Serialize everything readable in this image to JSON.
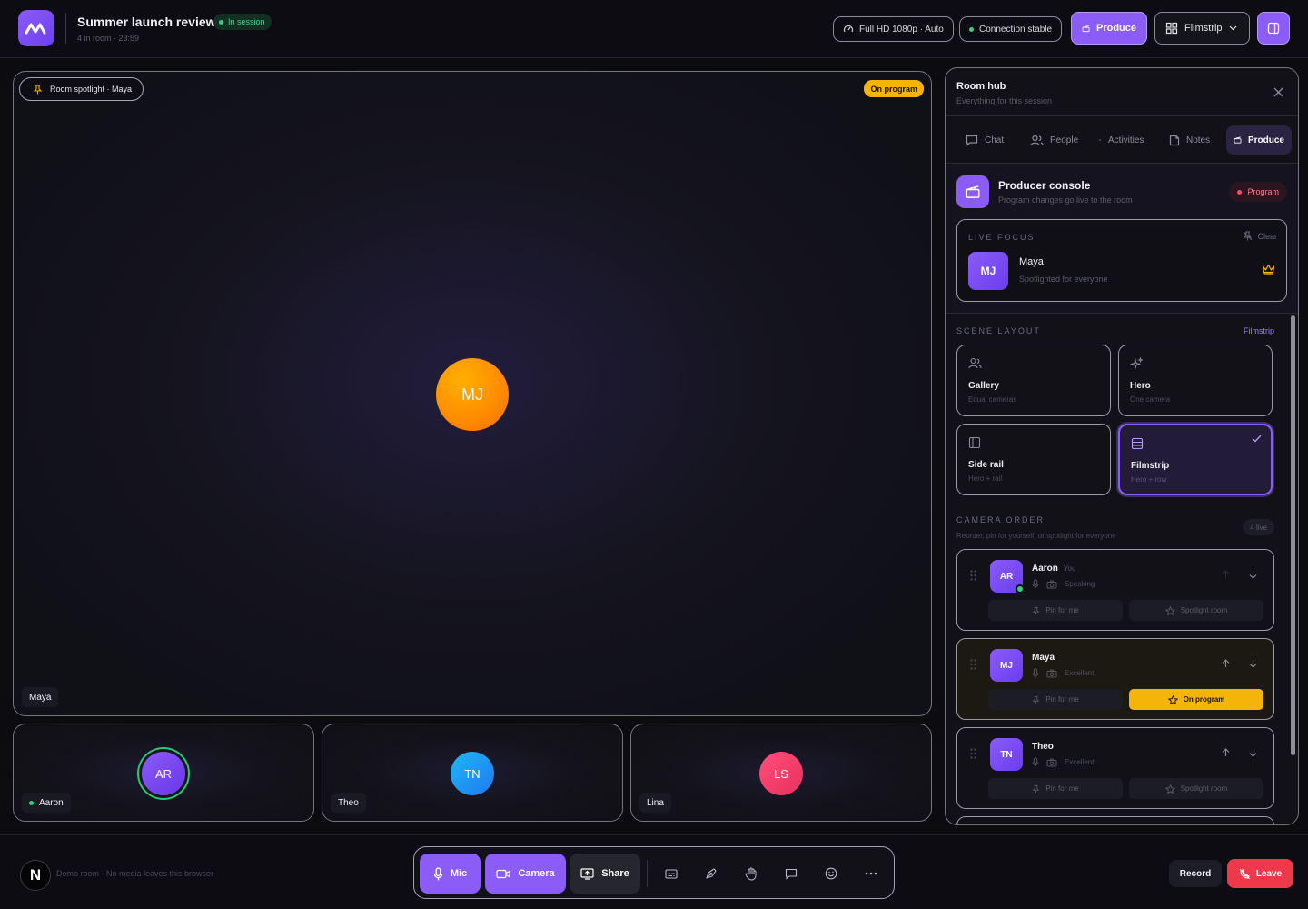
{
  "app": {
    "title": "Summer launch review",
    "status_badge": "In session",
    "subtitle": "4 in room · 23:59"
  },
  "topbar": {
    "quality_label": "Full HD 1080p · Auto",
    "connection_label": "Connection stable",
    "produce_label": "Produce",
    "layout_label": "Filmstrip"
  },
  "stage": {
    "spotlight_label": "Room spotlight · Maya",
    "program_badge": "On program",
    "avatar_initials": "MJ",
    "name": "Maya"
  },
  "tiles": [
    {
      "initials": "AR",
      "name": "Aaron",
      "speaking": true
    },
    {
      "initials": "TN",
      "name": "Theo"
    },
    {
      "initials": "LS",
      "name": "Lina"
    }
  ],
  "panel": {
    "title": "Room hub",
    "subtitle": "Everything for this session",
    "tabs": [
      {
        "label": "Chat",
        "icon": "chat-icon"
      },
      {
        "label": "People",
        "icon": "people-icon"
      },
      {
        "label": "Activities",
        "icon": "activities-icon"
      },
      {
        "label": "Notes",
        "icon": "notes-icon"
      },
      {
        "label": "Produce",
        "icon": "clapper-icon",
        "active": true
      }
    ],
    "console": {
      "title": "Producer console",
      "subtitle": "Program changes go live to the room",
      "badge": "Program"
    },
    "live_focus": {
      "label": "LIVE FOCUS",
      "clear_label": "Clear",
      "initials": "MJ",
      "name": "Maya",
      "sub": "Spotlighted for everyone"
    },
    "scene_layout": {
      "label": "SCENE LAYOUT",
      "current": "Filmstrip",
      "options": [
        {
          "name": "Gallery",
          "sub": "Equal cameras"
        },
        {
          "name": "Hero",
          "sub": "One camera"
        },
        {
          "name": "Side rail",
          "sub": "Hero + rail"
        },
        {
          "name": "Filmstrip",
          "sub": "Hero + row",
          "selected": true
        }
      ]
    },
    "camera_order": {
      "label": "CAMERA ORDER",
      "sub": "Reorder, pin for yourself, or spotlight for everyone",
      "count": "4 live",
      "you_label": "You",
      "pin_label": "Pin for me",
      "spotlight_label": "Spotlight room",
      "items": [
        {
          "initials": "AR",
          "name": "Aaron",
          "status": "Speaking",
          "action": "Spotlight room"
        },
        {
          "initials": "MJ",
          "name": "Maya",
          "status": "Excellent",
          "action": "On program"
        },
        {
          "initials": "TN",
          "name": "Theo",
          "status": "Excellent",
          "action": "Spotlight room"
        }
      ]
    }
  },
  "bottombar": {
    "logo_letter": "N",
    "demo_text": "Demo room · No media leaves this browser",
    "mic_label": "Mic",
    "camera_label": "Camera",
    "share_label": "Share",
    "record_label": "Record",
    "leave_label": "Leave"
  },
  "colors": {
    "accent": "#8b5cf6",
    "program": "#f5b40a",
    "danger": "#f0384b",
    "online": "#35d07f"
  }
}
